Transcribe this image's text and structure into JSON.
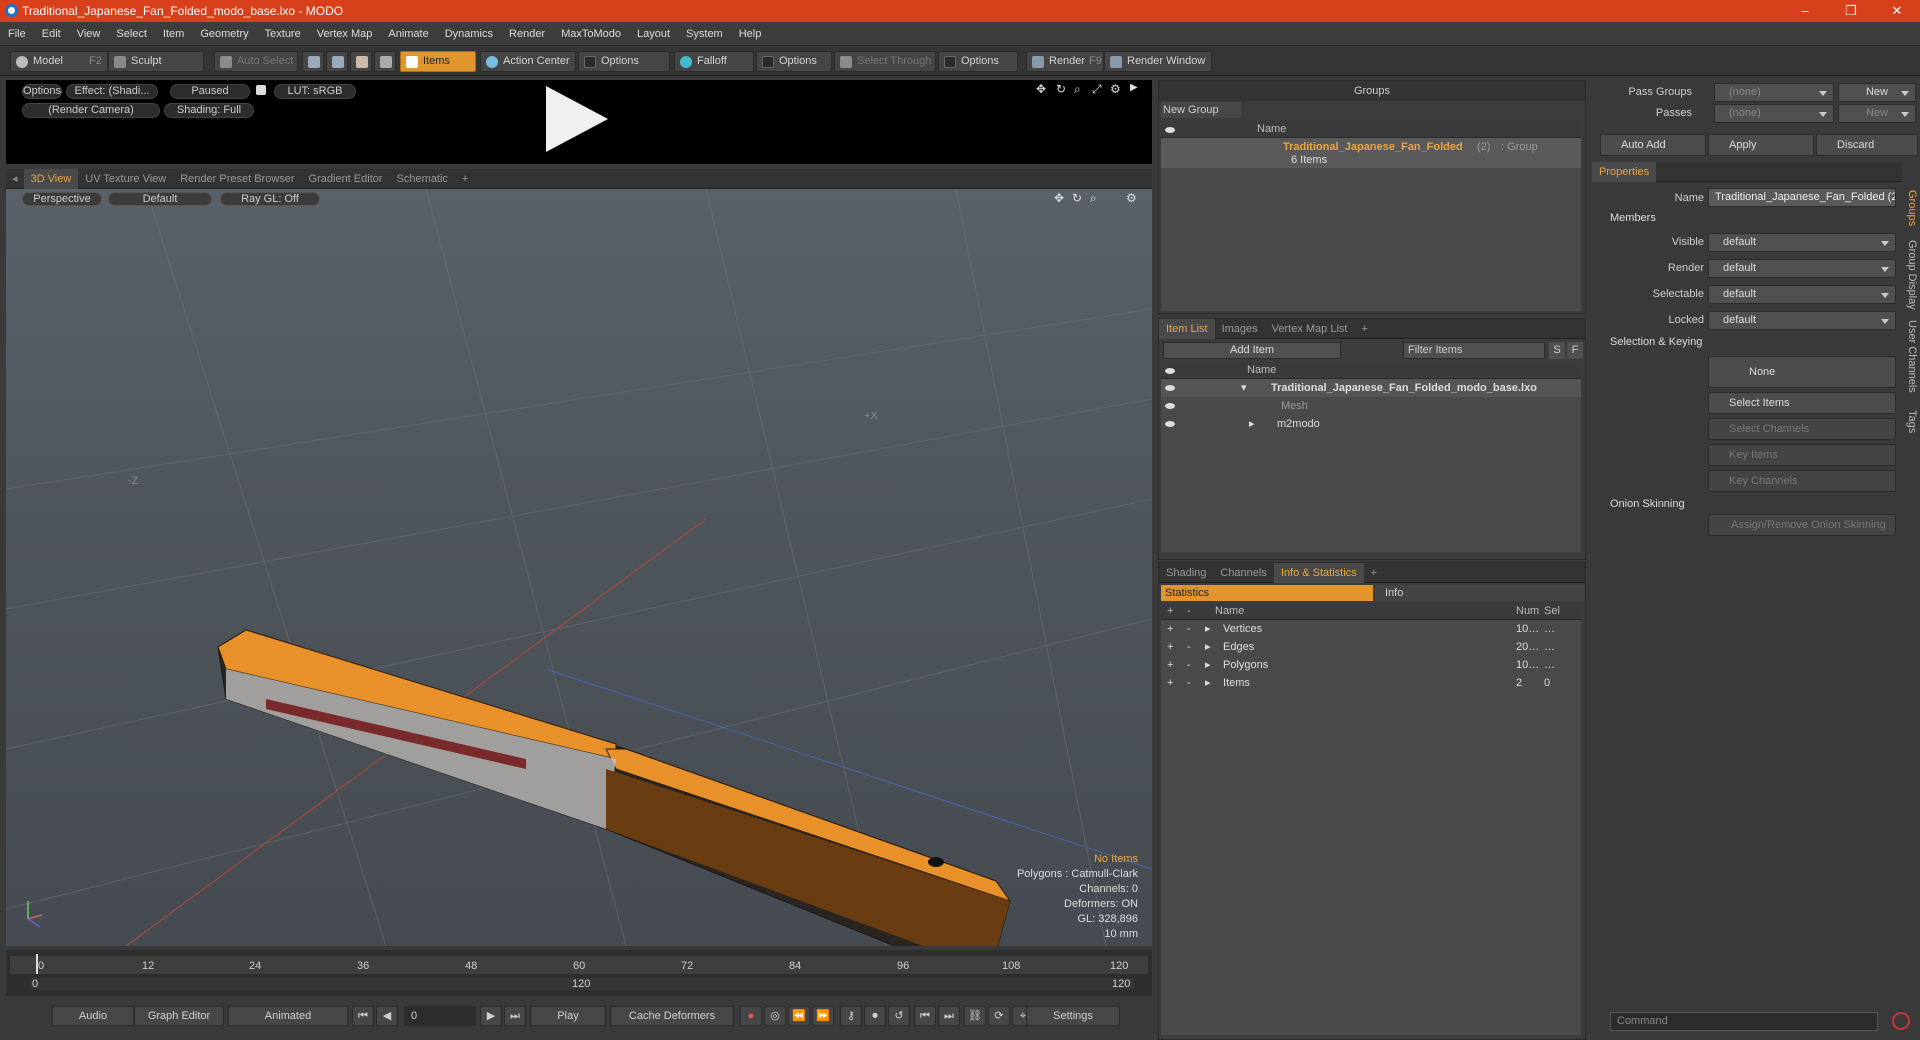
{
  "window": {
    "title": "Traditional_Japanese_Fan_Folded_modo_base.lxo - MODO",
    "minimize": "–",
    "maximize": "❐",
    "close": "✕"
  },
  "menu": [
    "File",
    "Edit",
    "View",
    "Select",
    "Item",
    "Geometry",
    "Texture",
    "Vertex Map",
    "Animate",
    "Dynamics",
    "Render",
    "MaxToModo",
    "Layout",
    "System",
    "Help"
  ],
  "toolbar": {
    "model": "Model",
    "model_key": "F2",
    "sculpt": "Sculpt",
    "auto_select": "Auto Select",
    "items": "Items",
    "action_center": "Action Center",
    "options1": "Options",
    "falloff": "Falloff",
    "options2": "Options",
    "select_through": "Select Through",
    "options3": "Options",
    "render": "Render",
    "render_key": "F9",
    "render_window": "Render Window"
  },
  "preview": {
    "options": "Options",
    "effect": "Effect: (Shadi...",
    "paused": "Paused",
    "lut": "LUT: sRGB",
    "camera": "(Render Camera)",
    "shading": "Shading: Full"
  },
  "viewtabs": [
    "3D View",
    "UV Texture View",
    "Render Preset Browser",
    "Gradient Editor",
    "Schematic",
    "+"
  ],
  "viewport": {
    "perspective": "Perspective",
    "default": "Default",
    "raygl": "Ray GL: Off",
    "axis_x": "+X",
    "axis_z": "-Z",
    "stats": {
      "no_items": "No Items",
      "polygons": "Polygons : Catmull-Clark",
      "channels": "Channels: 0",
      "deformers": "Deformers: ON",
      "gl": "GL: 328,896",
      "unit": "10 mm"
    }
  },
  "timeline": {
    "ticks": [
      "0",
      "12",
      "24",
      "36",
      "48",
      "60",
      "72",
      "84",
      "96",
      "108",
      "120"
    ],
    "range_start": "0",
    "range_mid": "120",
    "range_end": "120"
  },
  "bottombar": {
    "audio": "Audio",
    "graph_editor": "Graph Editor",
    "animated": "Animated",
    "frame": "0",
    "play": "Play",
    "cache_deformers": "Cache Deformers",
    "settings": "Settings"
  },
  "groups": {
    "header": "Groups",
    "new_group": "New Group",
    "col_name": "Name",
    "item_name": "Traditional_Japanese_Fan_Folded",
    "item_count": "(2)",
    "item_type": ": Group",
    "item_sub": "6 Items"
  },
  "itemlist": {
    "tabs": [
      "Item List",
      "Images",
      "Vertex Map List",
      "+"
    ],
    "add_item": "Add Item",
    "filter": "Filter Items",
    "s": "S",
    "f": "F",
    "col_name": "Name",
    "rows": [
      {
        "label": "Traditional_Japanese_Fan_Folded_modo_base.lxo"
      },
      {
        "label": "Mesh"
      },
      {
        "label": "m2modo"
      }
    ]
  },
  "infostats": {
    "tabs": [
      "Shading",
      "Channels",
      "Info & Statistics",
      "+"
    ],
    "statistics": "Statistics",
    "info": "Info",
    "col_name": "Name",
    "col_num": "Num",
    "col_sel": "Sel",
    "rows": [
      {
        "name": "Vertices",
        "num": "10…",
        "sel": "…"
      },
      {
        "name": "Edges",
        "num": "20…",
        "sel": "…"
      },
      {
        "name": "Polygons",
        "num": "10…",
        "sel": "…"
      },
      {
        "name": "Items",
        "num": "2",
        "sel": "0"
      }
    ]
  },
  "right": {
    "pass_groups": "Pass Groups",
    "passes": "Passes",
    "none1": "(none)",
    "none2": "(none)",
    "new1": "New",
    "new2": "New",
    "auto_add": "Auto Add",
    "apply": "Apply",
    "discard": "Discard",
    "properties": "Properties",
    "name_label": "Name",
    "name_value": "Traditional_Japanese_Fan_Folded (2",
    "members": "Members",
    "visible": "Visible",
    "render": "Render",
    "selectable": "Selectable",
    "locked": "Locked",
    "default": "default",
    "selection_keying": "Selection & Keying",
    "none": "None",
    "select_items": "Select Items",
    "select_channels": "Select Channels",
    "key_items": "Key Items",
    "key_channels": "Key Channels",
    "onion": "Onion Skinning",
    "assign_onion": "Assign/Remove Onion Skinning",
    "command": "Command",
    "vtabs": [
      "Groups",
      "Group Display",
      "User Channels",
      "Tags"
    ]
  }
}
